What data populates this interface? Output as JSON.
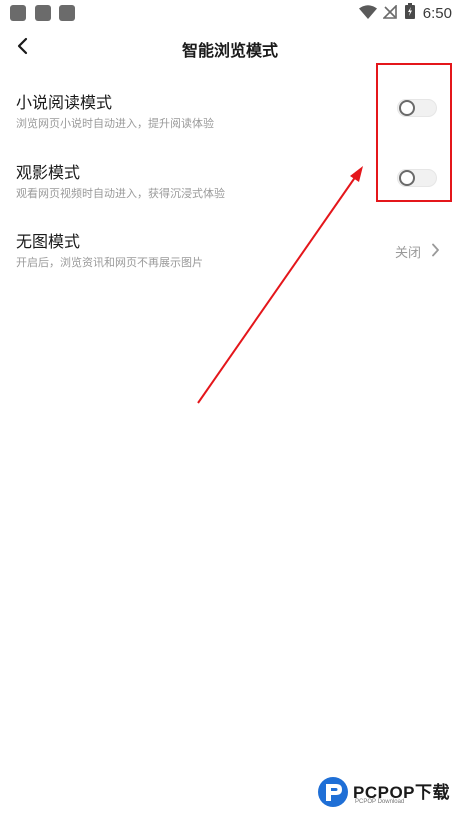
{
  "status_bar": {
    "time": "6:50",
    "icons": [
      "app-notification-icon",
      "app-notification-icon",
      "app-notification-icon",
      "wifi-icon",
      "no-signal-icon",
      "battery-charging-icon"
    ]
  },
  "header": {
    "title": "智能浏览模式",
    "back_icon": "chevron-left-icon"
  },
  "settings": [
    {
      "title": "小说阅读模式",
      "subtitle": "浏览网页小说时自动进入，提升阅读体验",
      "control": "toggle",
      "enabled": false
    },
    {
      "title": "观影模式",
      "subtitle": "观看网页视频时自动进入，获得沉浸式体验",
      "control": "toggle",
      "enabled": false
    },
    {
      "title": "无图模式",
      "subtitle": "开启后，浏览资讯和网页不再展示图片",
      "control": "value",
      "value": "关闭"
    }
  ],
  "annotation": {
    "color": "#e4161b"
  },
  "watermark": {
    "brand": "PCPOP下载",
    "sub": "PCPOP Download"
  }
}
